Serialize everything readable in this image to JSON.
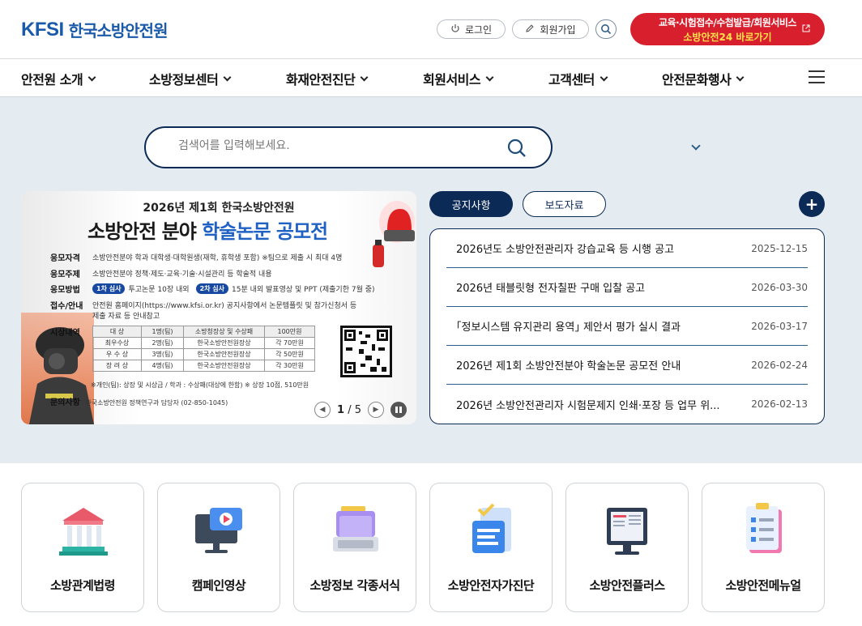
{
  "header": {
    "logo_mark": "KFSI",
    "logo_text": "한국소방안전원",
    "login": "로그인",
    "join": "회원가입",
    "cta_line1": "교육·시험접수/수첩발급/회원서비스",
    "cta_line2": "소방안전24 바로가기"
  },
  "gnb": [
    "안전원 소개",
    "소방정보센터",
    "화재안전진단",
    "회원서비스",
    "고객센터",
    "안전문화행사"
  ],
  "search": {
    "placeholder": "검색어를 입력해보세요."
  },
  "banner": {
    "subtitle": "2026년 제1회 한국소방안전원",
    "title_a": "소방안전 분야",
    "title_b": "학술논문 공모전",
    "rows": [
      {
        "label": "응모자격",
        "text": "소방안전분야 학과 대학생·대학원생(재학, 휴학생 포함)   ※팀으로 제출 시 최대 4명"
      },
      {
        "label": "응모주제",
        "text": "소방안전분야 정책·제도·교육·기술·시설관리 등 학술적 내용"
      },
      {
        "label": "응모방법",
        "stage1": "1차 심사",
        "text1": "투고논문 10장 내외",
        "stage2": "2차 심사",
        "text2": "15분 내외 발표영상 및 PPT (제출기한 7월 중)"
      },
      {
        "label": "접수/안내",
        "text": "안전원 홈페이지(https://www.kfsi.or.kr) 공지사항에서 논문템플릿 및 참가신청서 등"
      },
      {
        "label": "",
        "text": "제출 자료 등 안내참고"
      }
    ],
    "prize_label": "시상내역",
    "prize_table": [
      [
        "대    상",
        "1명(팀)",
        "소방청장상 및 수상패",
        "100만원"
      ],
      [
        "최우수상",
        "2명(팀)",
        "한국소방안전원장상",
        "각 70만원"
      ],
      [
        "우 수 상",
        "3명(팀)",
        "한국소방안전원장상",
        "각 50만원"
      ],
      [
        "장 려 상",
        "4명(팀)",
        "한국소방안전원장상",
        "각 30만원"
      ]
    ],
    "note": "※개인(팀): 상장 및 시상금 / 학과 : 수상패(대상에 한함)   ※ 상장 10점, 510만원",
    "contact_label": "문의사항",
    "contact": "한국소방안전원 정책연구과 담당자 (02-850-1045)",
    "page_current": "1",
    "page_total": "/ 5"
  },
  "tabs": {
    "active": "공지사항",
    "inactive": "보도자료"
  },
  "notices": [
    {
      "title": "2026년도 소방안전관리자 강습교육 등 시행 공고",
      "date": "2025-12-15"
    },
    {
      "title": "2026년 태블릿형 전자칠판 구매 입찰 공고",
      "date": "2026-03-30"
    },
    {
      "title": "｢정보시스템 유지관리 용역｣ 제안서 평가 실시 결과",
      "date": "2026-03-17"
    },
    {
      "title": "2026년 제1회 소방안전분야 학술논문 공모전 안내",
      "date": "2026-02-24"
    },
    {
      "title": "2026년 소방안전관리자 시험문제지 인쇄·포장 등 업무 위...",
      "date": "2026-02-13"
    }
  ],
  "cards": [
    {
      "label": "소방관계법령",
      "icon": "law-building-icon"
    },
    {
      "label": "캠페인영상",
      "icon": "video-monitor-icon"
    },
    {
      "label": "소방정보 각종서식",
      "icon": "folder-laptop-icon"
    },
    {
      "label": "소방안전자가진단",
      "icon": "checklist-scroll-icon"
    },
    {
      "label": "소방안전플러스",
      "icon": "monitor-book-icon"
    },
    {
      "label": "소방안전메뉴얼",
      "icon": "clipboard-check-icon"
    }
  ],
  "colors": {
    "brand": "#1a5aa8",
    "navy": "#0c2a56",
    "cta": "#d71f2d",
    "hero_bg": "#e4ecf2"
  }
}
